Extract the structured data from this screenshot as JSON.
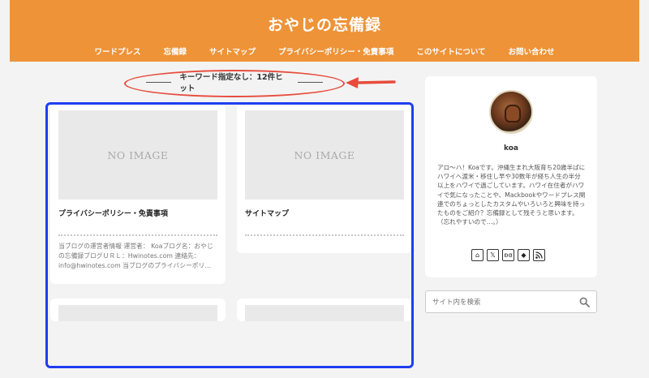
{
  "header": {
    "site_title": "おやじの忘備録",
    "nav": [
      "ワードプレス",
      "忘備録",
      "サイトマップ",
      "プライバシーポリシー・免責事項",
      "このサイトについて",
      "お問い合わせ"
    ]
  },
  "search_result": {
    "text": "キーワード指定なし：12件ヒット"
  },
  "cards": [
    {
      "thumb_text": "NO IMAGE",
      "title": "プライバシーポリシー・免責事項",
      "excerpt": "当ブログの運営者情報 運営者： Koaブログ名：おやじの忘備録ブログＵＲＬ：Hwinotes.com 連絡先：info@hwinotes.com 当ブログのプライバシーポリ…"
    },
    {
      "thumb_text": "NO IMAGE",
      "title": "サイトマップ",
      "excerpt": ""
    }
  ],
  "profile": {
    "name": "koa",
    "bio": "アロ〜ハ！Koaです。沖縄生まれ大阪育ち20歳半ばにハワイへ渡米・移住し早や30数年が経ち人生の半分以上をハワイで過ごしています。ハワイ在住者がハワイで気になったことや、Mackbookやワードプレス関連でのちょっとしたカスタムやいろいろと興味を持ったものをご紹介？忘備録として残そうと思います。（忘れやすいので…。）",
    "social_icons": [
      "home-icon",
      "x-icon",
      "butterfly-icon",
      "feedly-icon",
      "rss-icon"
    ]
  },
  "search": {
    "placeholder": "サイト内を検索"
  },
  "colors": {
    "header_bg": "#ee9338",
    "annotation_red": "#e74c3c",
    "annotation_blue": "#1e3ef0"
  }
}
